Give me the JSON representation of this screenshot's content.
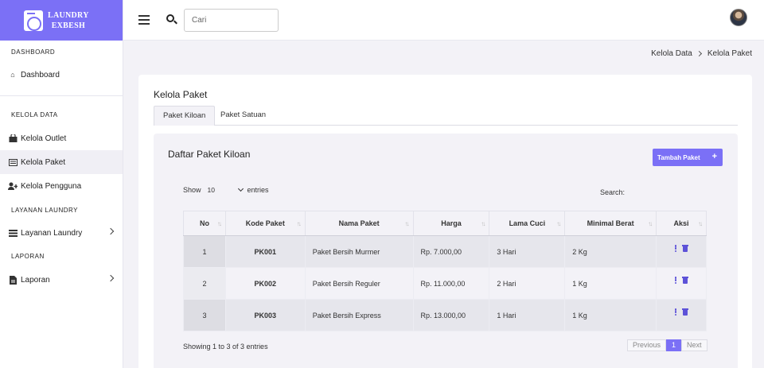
{
  "brand": {
    "line1": "LAUNDRY",
    "line2": "EXBESH"
  },
  "topbar": {
    "search_placeholder": "Cari"
  },
  "breadcrumb": {
    "parent": "Kelola Data",
    "current": "Kelola Paket"
  },
  "sidebar": {
    "sections": {
      "dashboard": "DASHBOARD",
      "kelola_data": "KELOLA DATA",
      "layanan": "LAYANAN LAUNDRY",
      "laporan": "LAPORAN"
    },
    "items": {
      "dashboard": "Dashboard",
      "outlet": "Kelola Outlet",
      "paket": "Kelola Paket",
      "pengguna": "Kelola Pengguna",
      "layanan": "Layanan Laundry",
      "laporan": "Laporan"
    }
  },
  "main": {
    "title": "Kelola Paket",
    "tabs": [
      "Paket Kiloan",
      "Paket Satuan"
    ],
    "list_title": "Daftar Paket Kiloan",
    "add_button": "Tambah Paket",
    "show_label": "Show",
    "entries_value": "10",
    "entries_label": "entries",
    "search_label": "Search:",
    "columns": [
      "No",
      "Kode Paket",
      "Nama Paket",
      "Harga",
      "Lama Cuci",
      "Minimal Berat",
      "Aksi"
    ],
    "rows": [
      {
        "no": "1",
        "kode": "PK001",
        "nama": "Paket Bersih Murmer",
        "harga": "Rp. 7.000,00",
        "lama": "3 Hari",
        "berat": "2 Kg"
      },
      {
        "no": "2",
        "kode": "PK002",
        "nama": "Paket Bersih Reguler",
        "harga": "Rp. 11.000,00",
        "lama": "2 Hari",
        "berat": "1 Kg"
      },
      {
        "no": "3",
        "kode": "PK003",
        "nama": "Paket Bersih Express",
        "harga": "Rp. 13.000,00",
        "lama": "1 Hari",
        "berat": "1 Kg"
      }
    ],
    "showing_text": "Showing 1 to 3 of 3 entries",
    "pager": {
      "previous": "Previous",
      "current": "1",
      "next": "Next"
    }
  },
  "colors": {
    "accent": "#7b70f6",
    "icon_accent": "#5d52d8",
    "background": "#f3f2f7"
  }
}
